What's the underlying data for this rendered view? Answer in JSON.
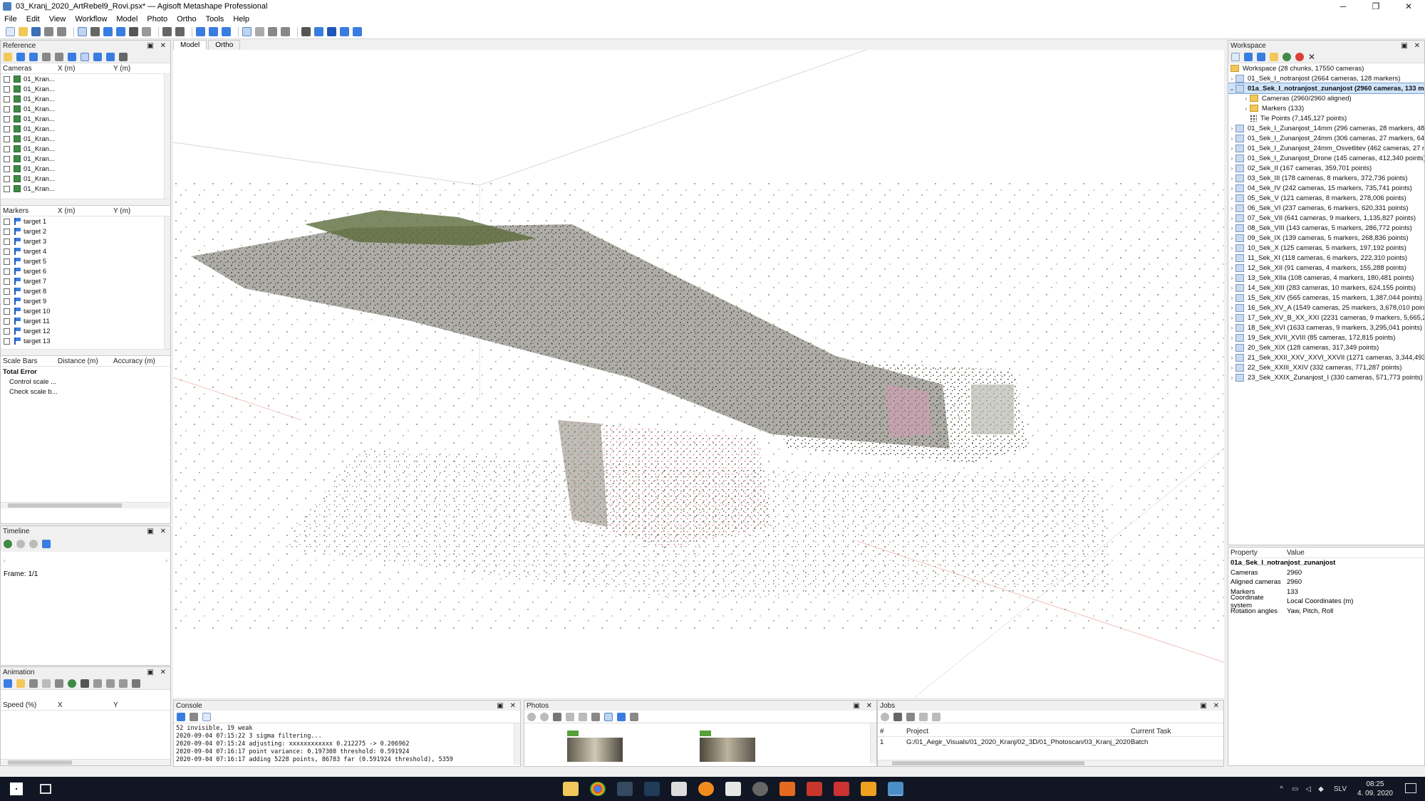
{
  "window": {
    "title": "03_Kranj_2020_ArtRebel9_Rovi.psx* — Agisoft Metashape Professional",
    "minimize": "─",
    "maximize": "❐",
    "close": "✕"
  },
  "menu": [
    "File",
    "Edit",
    "View",
    "Workflow",
    "Model",
    "Photo",
    "Ortho",
    "Tools",
    "Help"
  ],
  "reference": {
    "title": "Reference",
    "cameras_header": [
      "Cameras",
      "X (m)",
      "Y (m)"
    ],
    "cameras": [
      "01_Kran...",
      "01_Kran...",
      "01_Kran...",
      "01_Kran...",
      "01_Kran...",
      "01_Kran...",
      "01_Kran...",
      "01_Kran...",
      "01_Kran...",
      "01_Kran...",
      "01_Kran...",
      "01_Kran...",
      "01_Kran..."
    ],
    "markers_header": [
      "Markers",
      "X (m)",
      "Y (m)"
    ],
    "markers": [
      "target 1",
      "target 2",
      "target 3",
      "target 4",
      "target 5",
      "target 6",
      "target 7",
      "target 8",
      "target 9",
      "target 10",
      "target 11",
      "target 12",
      "target 13"
    ],
    "scalebars_header": [
      "Scale Bars",
      "Distance (m)",
      "Accuracy (m)"
    ],
    "total_error": "Total Error",
    "control_scale": "Control scale ...",
    "check_scale": "Check scale b..."
  },
  "timeline": {
    "title": "Timeline",
    "frame": "Frame: 1/1"
  },
  "animation": {
    "title": "Animation",
    "header": [
      "Speed (%)",
      "X",
      "Y"
    ]
  },
  "view_tabs": [
    "Model",
    "Ortho"
  ],
  "console": {
    "title": "Console",
    "lines": [
      "52 invisible, 19 weak",
      "2020-09-04 07:15:22 3 sigma filtering...",
      "2020-09-04 07:15:24 adjusting: xxxxxxxxxxxx 0.212275 -> 0.206962",
      "2020-09-04 07:16:17 point variance: 0.197308 threshold: 0.591924",
      "2020-09-04 07:16:17 adding 5228 points, 86783 far (0.591924 threshold), 5359"
    ]
  },
  "photos": {
    "title": "Photos"
  },
  "jobs": {
    "title": "Jobs",
    "header": [
      "#",
      "Project",
      "Current Task"
    ],
    "row": [
      "1",
      "G:/01_Aegir_Visuals/01_2020_Kranj/02_3D/01_Photoscan/03_Kranj_2020_...",
      "Batch"
    ]
  },
  "workspace": {
    "title": "Workspace",
    "root": "Workspace (28 chunks, 17550 cameras)",
    "chunks": [
      "01_Sek_I_notranjost (2664 cameras, 128 markers)",
      "01a_Sek_I_notranjost_zunanjost (2960 cameras, 133 ma",
      "Cameras (2960/2960 aligned)",
      "Markers (133)",
      "Tie Points (7,145,127 points)",
      "01_Sek_I_Zunanjost_14mm (296 cameras, 28 markers, 487,5",
      "01_Sek_I_Zunanjost_24mm (306 cameras, 27 markers, 649,3",
      "01_Sek_I_Zunanjost_24mm_Osvetlitev (462 cameras, 27 mar",
      "01_Sek_I_Zunanjost_Drone (145 cameras, 412,340 points) [f",
      "02_Sek_II (167 cameras, 359,701 points)",
      "03_Sek_III (178 cameras, 8 markers, 372,736 points)",
      "04_Sek_IV (242 cameras, 15 markers, 735,741 points)",
      "05_Sek_V (121 cameras, 8 markers, 278,006 points)",
      "06_Sek_VI (237 cameras, 6 markers, 620,331 points)",
      "07_Sek_VII (641 cameras, 9 markers, 1,135,827 points)",
      "08_Sek_VIII (143 cameras, 5 markers, 286,772 points)",
      "09_Sek_IX (139 cameras, 5 markers, 268,836 points)",
      "10_Sek_X (125 cameras, 5 markers, 197,192 points)",
      "11_Sek_XI (118 cameras, 6 markers, 222,310 points)",
      "12_Sek_XII (91 cameras, 4 markers, 155,288 points)",
      "13_Sek_XIIa (108 cameras, 4 markers, 180,481 points)",
      "14_Sek_XIII (283 cameras, 10 markers, 624,155 points)",
      "15_Sek_XIV (565 cameras, 15 markers, 1,387,044 points)",
      "16_Sek_XV_A (1549 cameras, 25 markers, 3,678,010 points)",
      "17_Sek_XV_B_XX_XXI (2231 cameras, 9 markers, 5,665,209 p",
      "18_Sek_XVI (1633 cameras, 9 markers, 3,295,041 points)",
      "19_Sek_XVII_XVIII (85 cameras, 172,815 points)",
      "20_Sek_XIX (128 cameras, 317,349 points)",
      "21_Sek_XXII_XXV_XXVI_XXVII (1271 cameras, 3,344,493 poin",
      "22_Sek_XXIII_XXIV (332 cameras, 771,287 points)",
      "23_Sek_XXIX_Zunanjost_I (330 cameras, 571,773 points)"
    ]
  },
  "properties": {
    "header": [
      "Property",
      "Value"
    ],
    "chunk": "01a_Sek_I_notranjost_zunanjost",
    "rows": [
      [
        "Cameras",
        "2960"
      ],
      [
        "Aligned cameras",
        "2960"
      ],
      [
        "Markers",
        "133"
      ],
      [
        "Coordinate system",
        "Local Coordinates (m)"
      ],
      [
        "Rotation angles",
        "Yaw, Pitch, Roll"
      ]
    ]
  },
  "taskbar": {
    "lang": "SLV",
    "time": "08:25",
    "date": "4. 09. 2020"
  },
  "colors": {
    "accent": "#0078d7",
    "selection": "#cfe3fb",
    "taskbar": "#101623"
  }
}
